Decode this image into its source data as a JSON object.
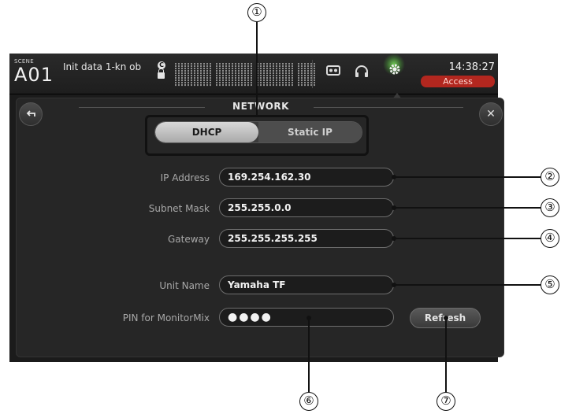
{
  "status_bar": {
    "scene_caption": "SCENE",
    "scene_number": "A01",
    "scene_title": "Init data 1-kn ob",
    "time": "14:38:27",
    "access_label": "Access",
    "icons": [
      "c-icon",
      "lock-icon",
      "recorder-icon",
      "headphones-icon",
      "gear-icon"
    ]
  },
  "dialog": {
    "title": "NETWORK",
    "back_icon": "back-arrow-icon",
    "close_icon": "close-icon",
    "mode_selector": {
      "options": [
        "DHCP",
        "Static IP"
      ],
      "selected": "DHCP"
    },
    "fields": {
      "ip_address": {
        "label": "IP Address",
        "value": "169.254.162.30"
      },
      "subnet_mask": {
        "label": "Subnet Mask",
        "value": "255.255.0.0"
      },
      "gateway": {
        "label": "Gateway",
        "value": "255.255.255.255"
      },
      "unit_name": {
        "label": "Unit Name",
        "value": "Yamaha TF"
      },
      "pin": {
        "label": "PIN for MonitorMix",
        "value": "●●●●"
      }
    },
    "refresh_label": "Refresh"
  },
  "callouts": [
    "①",
    "②",
    "③",
    "④",
    "⑤",
    "⑥",
    "⑦"
  ]
}
